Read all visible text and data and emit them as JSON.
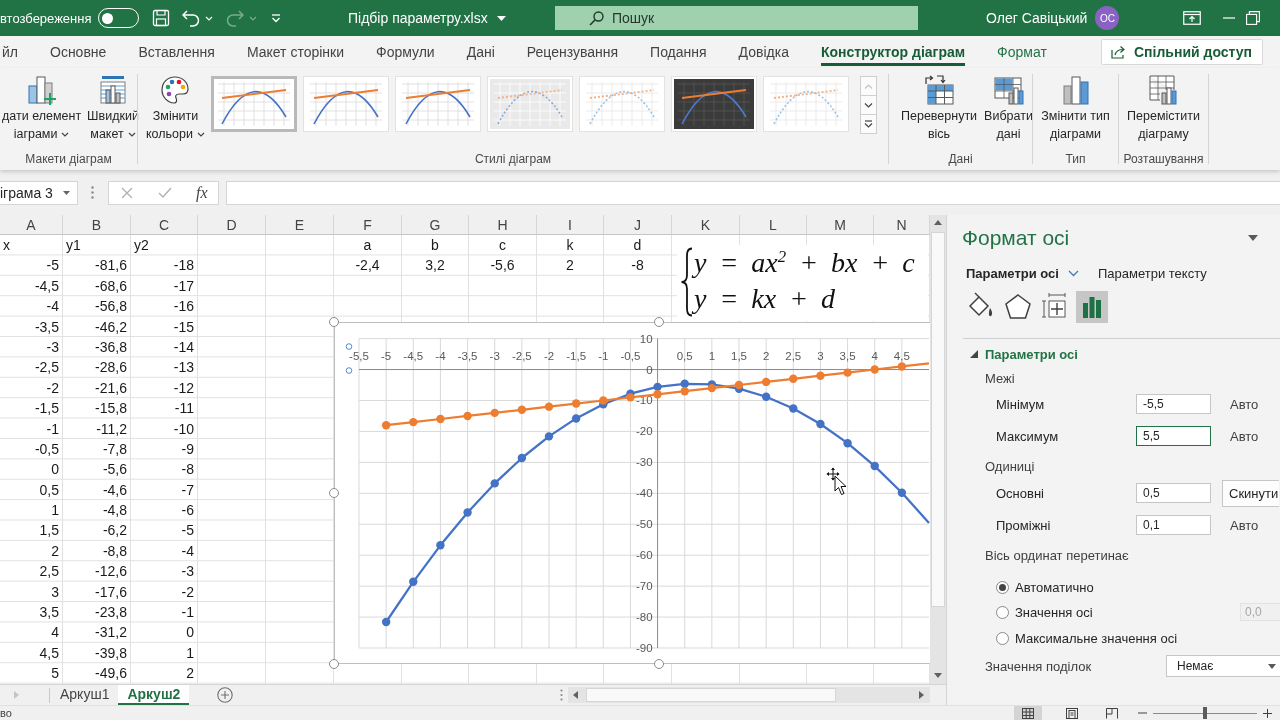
{
  "title_bar": {
    "autosave": {
      "label": "втозбереження",
      "on": false
    },
    "quick_access": {
      "undo": {
        "disabled": false
      },
      "redo": {
        "disabled": true
      }
    },
    "file_name": "Підбір параметру.xlsx",
    "search": {
      "placeholder": "Пошук"
    },
    "user": {
      "name": "Олег Савіцький",
      "initials": "ОС"
    }
  },
  "ribbon": {
    "tabs": [
      {
        "label": "йл",
        "selected": false,
        "contextual": false
      },
      {
        "label": "Основне",
        "selected": false,
        "contextual": false
      },
      {
        "label": "Вставлення",
        "selected": false,
        "contextual": false
      },
      {
        "label": "Макет сторінки",
        "selected": false,
        "contextual": false
      },
      {
        "label": "Формули",
        "selected": false,
        "contextual": false
      },
      {
        "label": "Дані",
        "selected": false,
        "contextual": false
      },
      {
        "label": "Рецензування",
        "selected": false,
        "contextual": false
      },
      {
        "label": "Подання",
        "selected": false,
        "contextual": false
      },
      {
        "label": "Довідка",
        "selected": false,
        "contextual": false
      },
      {
        "label": "Конструктор діаграм",
        "selected": true,
        "contextual": true
      },
      {
        "label": "Формат",
        "selected": false,
        "contextual": true
      }
    ],
    "share_button": "Спільний доступ",
    "groups": [
      {
        "label": "Макети діаграм",
        "buttons": [
          {
            "kind": "add",
            "lines": [
              "дати елемент",
              "іаграми"
            ],
            "menu": true
          },
          {
            "kind": "layout",
            "lines": [
              "Швидкий",
              "макет"
            ],
            "menu": true
          }
        ]
      },
      {
        "label": "Стилі діаграм",
        "buttons": [
          {
            "kind": "colors",
            "lines": [
              "Змінити",
              "кольори"
            ],
            "menu": true
          }
        ],
        "gallery": {
          "up_disabled": true,
          "styles": [
            {
              "kind": "plain",
              "selected": true
            },
            {
              "kind": "plain",
              "selected": false
            },
            {
              "kind": "plain",
              "selected": false
            },
            {
              "kind": "shaded",
              "selected": false
            },
            {
              "kind": "faded",
              "selected": false
            },
            {
              "kind": "dark",
              "selected": false
            },
            {
              "kind": "faded",
              "selected": false
            }
          ]
        }
      },
      {
        "label": "Дані",
        "buttons": [
          {
            "kind": "switch",
            "lines": [
              "Перевернути",
              "вісь"
            ],
            "menu": false
          },
          {
            "kind": "select",
            "lines": [
              "Вибрати",
              "дані"
            ],
            "menu": false
          }
        ]
      },
      {
        "label": "Тип",
        "buttons": [
          {
            "kind": "charttype",
            "lines": [
              "Змінити тип",
              "діаграми"
            ],
            "menu": false
          }
        ]
      },
      {
        "label": "Розташування",
        "buttons": [
          {
            "kind": "move",
            "lines": [
              "Перемістити",
              "діаграму"
            ],
            "menu": false
          }
        ]
      }
    ]
  },
  "formula_bar": {
    "name_box": "іграма 3",
    "cancel_disabled": true,
    "enter_disabled": true,
    "function_label": "fx"
  },
  "sheet": {
    "columns": [
      "A",
      "B",
      "C",
      "D",
      "E",
      "F",
      "G",
      "H",
      "I",
      "J",
      "K",
      "L",
      "M",
      "N"
    ],
    "xy_table": {
      "headers": [
        "x",
        "y1",
        "y2"
      ],
      "rows": [
        [
          "-5",
          "-81,6",
          "-18"
        ],
        [
          "-4,5",
          "-68,6",
          "-17"
        ],
        [
          "-4",
          "-56,8",
          "-16"
        ],
        [
          "-3,5",
          "-46,2",
          "-15"
        ],
        [
          "-3",
          "-36,8",
          "-14"
        ],
        [
          "-2,5",
          "-28,6",
          "-13"
        ],
        [
          "-2",
          "-21,6",
          "-12"
        ],
        [
          "-1,5",
          "-15,8",
          "-11"
        ],
        [
          "-1",
          "-11,2",
          "-10"
        ],
        [
          "-0,5",
          "-7,8",
          "-9"
        ],
        [
          "0",
          "-5,6",
          "-8"
        ],
        [
          "0,5",
          "-4,6",
          "-7"
        ],
        [
          "1",
          "-4,8",
          "-6"
        ],
        [
          "1,5",
          "-6,2",
          "-5"
        ],
        [
          "2",
          "-8,8",
          "-4"
        ],
        [
          "2,5",
          "-12,6",
          "-3"
        ],
        [
          "3",
          "-17,6",
          "-2"
        ],
        [
          "3,5",
          "-23,8",
          "-1"
        ],
        [
          "4",
          "-31,2",
          "0"
        ],
        [
          "4,5",
          "-39,8",
          "1"
        ],
        [
          "5",
          "-49,6",
          "2"
        ]
      ]
    },
    "coefficients": {
      "names": [
        "a",
        "b",
        "c",
        "k",
        "d"
      ],
      "values": [
        "-2,4",
        "3,2",
        "-5,6",
        "2",
        "-8"
      ]
    },
    "equation": [
      "y = ax$^{2}$ + bx + c",
      "y = kx + d"
    ],
    "chart": {
      "chart_data": {
        "type": "line",
        "x": [
          -5,
          -4.5,
          -4,
          -3.5,
          -3,
          -2.5,
          -2,
          -1.5,
          -1,
          -0.5,
          0,
          0.5,
          1,
          1.5,
          2,
          2.5,
          3,
          3.5,
          4,
          4.5,
          5
        ],
        "series": [
          {
            "color": "#4472c4",
            "marker": true,
            "values": [
              -81.6,
              -68.6,
              -56.8,
              -46.2,
              -36.8,
              -28.6,
              -21.6,
              -15.8,
              -11.2,
              -7.8,
              -5.6,
              -4.6,
              -4.8,
              -6.2,
              -8.8,
              -12.6,
              -17.6,
              -23.8,
              -31.2,
              -39.8,
              -49.6
            ]
          },
          {
            "color": "#ed7d31",
            "marker": true,
            "values": [
              -18,
              -17,
              -16,
              -15,
              -14,
              -13,
              -12,
              -11,
              -10,
              -9,
              -8,
              -7,
              -6,
              -5,
              -4,
              -3,
              -2,
              -1,
              0,
              1,
              2
            ]
          }
        ],
        "xlim": [
          -5.5,
          5
        ],
        "ylim": [
          -90,
          10
        ],
        "grid": true,
        "xticks": [
          {
            "value": -5.5,
            "label": "-5,5"
          },
          -5,
          {
            "value": -4.5,
            "label": "-4,5"
          },
          -4,
          {
            "value": -3.5,
            "label": "-3,5"
          },
          -3,
          {
            "value": -2.5,
            "label": "-2,5"
          },
          -2,
          {
            "value": -1.5,
            "label": "-1,5"
          },
          -1,
          {
            "value": -0.5,
            "label": "-0,5"
          },
          {
            "value": 0.5,
            "label": "0,5"
          },
          1,
          {
            "value": 1.5,
            "label": "1,5"
          },
          2,
          {
            "value": 2.5,
            "label": "2,5"
          },
          3,
          {
            "value": 3.5,
            "label": "3,5"
          },
          4,
          {
            "value": 4.5,
            "label": "4,5"
          }
        ],
        "yticks": [
          10,
          0,
          -10,
          -20,
          -30,
          -40,
          -50,
          -60,
          -70,
          -80,
          -90
        ]
      }
    }
  },
  "sheet_tabs": [
    {
      "label": "Аркуш1",
      "selected": false
    },
    {
      "label": "Аркуш2",
      "selected": true
    }
  ],
  "format_pane": {
    "title": "Формат осі",
    "tabs": [
      {
        "label": "Параметри осі",
        "selected": true
      },
      {
        "label": "Параметри тексту",
        "selected": false
      }
    ],
    "icon_tabs": [
      {
        "kind": "fill",
        "selected": false
      },
      {
        "kind": "effects",
        "selected": false
      },
      {
        "kind": "size",
        "selected": false
      },
      {
        "kind": "axis",
        "selected": true
      }
    ],
    "section": {
      "title": "Параметри осі",
      "expanded": true
    },
    "groups": [
      {
        "label": "Межі",
        "rows": [
          {
            "label": "Мінімум",
            "value": "-5,5",
            "focused": false,
            "action": {
              "kind": "label",
              "text": "Авто"
            }
          },
          {
            "label": "Максимум",
            "value": "5,5",
            "focused": true,
            "action": {
              "kind": "label",
              "text": "Авто"
            }
          }
        ]
      },
      {
        "label": "Одиниці",
        "rows": [
          {
            "label": "Основні",
            "value": "0,5",
            "focused": false,
            "action": {
              "kind": "button",
              "text": "Скинути"
            }
          },
          {
            "label": "Проміжні",
            "value": "0,1",
            "focused": false,
            "action": {
              "kind": "label",
              "text": "Авто"
            }
          }
        ]
      }
    ],
    "crosses": {
      "label": "Вісь ординат перетинає",
      "options": [
        {
          "label": "Автоматично",
          "selected": true
        },
        {
          "label": "Значення осі",
          "selected": false,
          "field": {
            "value": "0,0",
            "disabled": true
          }
        },
        {
          "label": "Максимальне значення осі",
          "selected": false
        }
      ]
    },
    "tick_labels": {
      "label": "Значення поділок",
      "value": "Немає"
    }
  },
  "status_bar": {
    "text": "во",
    "views": [
      {
        "kind": "normal",
        "selected": true
      },
      {
        "kind": "layout",
        "selected": false
      },
      {
        "kind": "breaks",
        "selected": false
      }
    ],
    "zoom": {
      "level": 0.5
    }
  }
}
